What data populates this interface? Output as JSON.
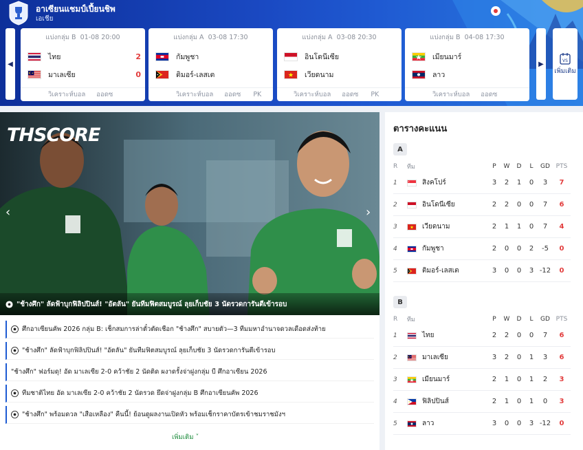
{
  "site": {
    "title": "อาเซียนแชมป์เปี้ยนชิพ",
    "subtitle": "เอเชีย"
  },
  "matches": [
    {
      "group": "แบ่งกลุ่ม B",
      "date": "01-08 20:00",
      "home": {
        "name": "ไทย",
        "flag": "thailand",
        "score": "2"
      },
      "away": {
        "name": "มาเลเซีย",
        "flag": "malaysia",
        "score": "0"
      },
      "links": [
        "วิเคราะห์บอล",
        "ออดซ"
      ]
    },
    {
      "group": "แบ่งกลุ่ม A",
      "date": "03-08 17:30",
      "home": {
        "name": "กัมพูชา",
        "flag": "cambodia",
        "score": ""
      },
      "away": {
        "name": "ติมอร์-เลสเต",
        "flag": "timor-leste",
        "score": ""
      },
      "links": [
        "วิเคราะห์บอล",
        "ออดซ",
        "PK"
      ]
    },
    {
      "group": "แบ่งกลุ่ม A",
      "date": "03-08 20:30",
      "home": {
        "name": "อินโดนีเซีย",
        "flag": "indonesia",
        "score": ""
      },
      "away": {
        "name": "เวียดนาม",
        "flag": "vietnam",
        "score": ""
      },
      "links": [
        "วิเคราะห์บอล",
        "ออดซ",
        "PK"
      ]
    },
    {
      "group": "แบ่งกลุ่ม B",
      "date": "04-08 17:30",
      "home": {
        "name": "เมียนมาร์",
        "flag": "myanmar",
        "score": ""
      },
      "away": {
        "name": "ลาว",
        "flag": "laos",
        "score": ""
      },
      "links": [
        "วิเคราะห์บอล",
        "ออดซ"
      ]
    }
  ],
  "more_button": {
    "label": "เพิ่มเติม",
    "icon": "vs-calendar-icon"
  },
  "hero": {
    "brand_prefix": "TH",
    "brand_suffix": "SCORE",
    "caption": "\"ช้างศึก\" ลัดฟ้าบุกฟิลิปปินส์! \"อัตลัน\" ยันทีมฟิตสมบูรณ์ ลุยเก็บชัย 3 นัดรวดการันตีเข้ารอบ",
    "prev_icon": "chevron-left-icon",
    "next_icon": "chevron-right-icon"
  },
  "news": [
    "ศึกอาเซียนคัพ 2026 กลุ่ม B: เช็กสมการล่าตั๋วตัดเชือก \"ช้างศึก\" สบายตัว—3 ทีมมหาอำนาจดวลเดือดส่งท้าย",
    "\"ช้างศึก\" ลัดฟ้าบุกฟิลิปปินส์! \"อัตลัน\" ยันทีมฟิตสมบูรณ์ ลุยเก็บชัย 3 นัดรวดการันตีเข้ารอบ",
    "\"ช้างศึก\" ฟอร์มดุ! อัด มาเลเซีย 2-0 คว้าชัย 2 นัดติด ผงาดรั้งจ่าฝูงกลุ่ม บี ศึกอาเซียน 2026",
    "ทีมชาติไทย อัด มาเลเซีย 2-0 คว้าชัย 2 นัดรวด ยึดจ่าฝูงกลุ่ม B ศึกอาเซียนคัพ 2026",
    "\"ช้างศึก\" พร้อมดวล \"เสือเหลือง\" คืนนี้! ย้อนดูผลงานเปิดหัว พร้อมเช็กราคาบัตรเข้าชมราชมังฯ"
  ],
  "news_more": "เพิ่มเติม ˅",
  "standings": {
    "title": "ตารางคะแนน",
    "headers": {
      "r": "R",
      "team": "ทีม",
      "p": "P",
      "w": "W",
      "d": "D",
      "l": "L",
      "gd": "GD",
      "pts": "PTS"
    },
    "groups": [
      {
        "name": "A",
        "rows": [
          {
            "r": "1",
            "team": "สิงคโปร์",
            "flag": "singapore",
            "p": "3",
            "w": "2",
            "d": "1",
            "l": "0",
            "gd": "3",
            "pts": "7"
          },
          {
            "r": "2",
            "team": "อินโดนีเซีย",
            "flag": "indonesia",
            "p": "2",
            "w": "2",
            "d": "0",
            "l": "0",
            "gd": "7",
            "pts": "6"
          },
          {
            "r": "3",
            "team": "เวียดนาม",
            "flag": "vietnam",
            "p": "2",
            "w": "1",
            "d": "1",
            "l": "0",
            "gd": "7",
            "pts": "4"
          },
          {
            "r": "4",
            "team": "กัมพูชา",
            "flag": "cambodia",
            "p": "2",
            "w": "0",
            "d": "0",
            "l": "2",
            "gd": "-5",
            "pts": "0"
          },
          {
            "r": "5",
            "team": "ติมอร์-เลสเต",
            "flag": "timor-leste",
            "p": "3",
            "w": "0",
            "d": "0",
            "l": "3",
            "gd": "-12",
            "pts": "0"
          }
        ]
      },
      {
        "name": "B",
        "rows": [
          {
            "r": "1",
            "team": "ไทย",
            "flag": "thailand",
            "p": "2",
            "w": "2",
            "d": "0",
            "l": "0",
            "gd": "7",
            "pts": "6"
          },
          {
            "r": "2",
            "team": "มาเลเซีย",
            "flag": "malaysia",
            "p": "3",
            "w": "2",
            "d": "0",
            "l": "1",
            "gd": "3",
            "pts": "6"
          },
          {
            "r": "3",
            "team": "เมียนมาร์",
            "flag": "myanmar",
            "p": "2",
            "w": "1",
            "d": "0",
            "l": "1",
            "gd": "2",
            "pts": "3"
          },
          {
            "r": "4",
            "team": "ฟิลิปปินส์",
            "flag": "philippines",
            "p": "2",
            "w": "1",
            "d": "0",
            "l": "1",
            "gd": "0",
            "pts": "3"
          },
          {
            "r": "5",
            "team": "ลาว",
            "flag": "laos",
            "p": "3",
            "w": "0",
            "d": "0",
            "l": "3",
            "gd": "-12",
            "pts": "0"
          }
        ]
      }
    ]
  },
  "colors": {
    "header": "#1a49c2",
    "score": "#e23c3c",
    "pts": "#e23c3c",
    "accent": "#1b5ad2",
    "more_link": "#1a8a3a"
  }
}
